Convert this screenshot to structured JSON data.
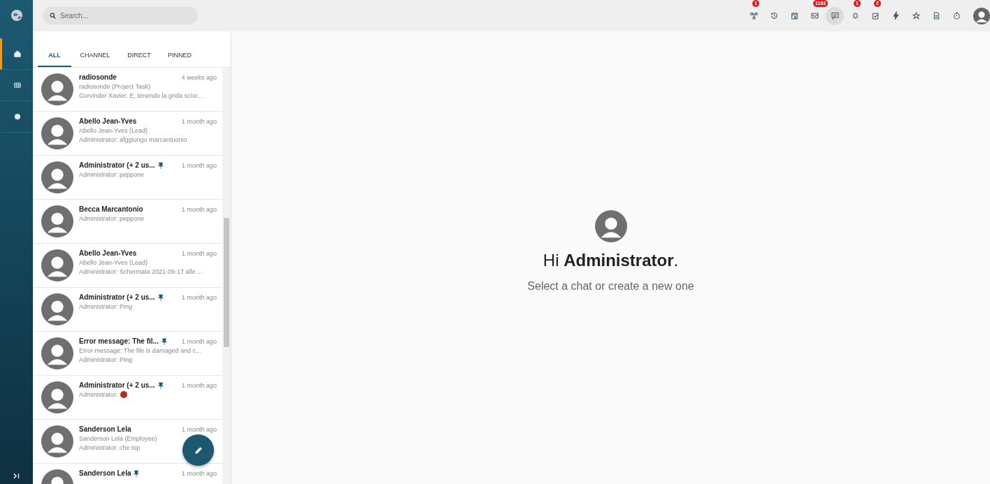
{
  "nav": {
    "items": [
      {
        "kind": "home",
        "selected": true
      },
      {
        "kind": "grid",
        "selected": false
      },
      {
        "kind": "gear",
        "selected": false
      }
    ]
  },
  "search": {
    "placeholder": "Search..."
  },
  "toolbar": {
    "items": [
      {
        "kind": "network",
        "badge": "1",
        "selected": false
      },
      {
        "kind": "history",
        "selected": false
      },
      {
        "kind": "calendar",
        "selected": false
      },
      {
        "kind": "mail",
        "badge": "1163",
        "selected": false
      },
      {
        "kind": "chat",
        "selected": true
      },
      {
        "kind": "bell",
        "badge": "1",
        "selected": false
      },
      {
        "kind": "task",
        "badge": "2",
        "selected": false
      },
      {
        "kind": "bolt",
        "selected": false
      },
      {
        "kind": "star",
        "selected": false
      },
      {
        "kind": "document",
        "selected": false
      },
      {
        "kind": "timer",
        "selected": false
      }
    ]
  },
  "tabs": [
    {
      "label": "ALL",
      "selected": true
    },
    {
      "label": "CHANNEL",
      "selected": false
    },
    {
      "label": "DIRECT",
      "selected": false
    },
    {
      "label": "PINNED",
      "selected": false
    }
  ],
  "chats": [
    {
      "title": "radiosonde",
      "pinned": false,
      "time": "4 weeks ago",
      "subtitle": "radiosonde (Project Task)",
      "preview": "Gurvinder Xavier: E, tenendo la grida scior..."
    },
    {
      "title": "Abello Jean-Yves",
      "pinned": false,
      "time": "1 month ago",
      "subtitle": "Abello Jean-Yves (Lead)",
      "preview": "Administrator: afggiungo marcantuonio"
    },
    {
      "title": "Administrator (+ 2 us...",
      "pinned": true,
      "time": "1 month ago",
      "preview": "Administrator: peppone"
    },
    {
      "title": "Becca Marcantonio",
      "pinned": false,
      "time": "1 month ago",
      "preview": "Administrator: peppone"
    },
    {
      "title": "Abello Jean-Yves",
      "pinned": false,
      "time": "1 month ago",
      "subtitle": "Abello Jean-Yves (Lead)",
      "preview": "Administrator: Schermata 2021-09-17 alle ..."
    },
    {
      "title": "Administrator (+ 2 us...",
      "pinned": true,
      "time": "1 month ago",
      "preview": "Administrator: Ping"
    },
    {
      "title": "Error message: The fil...",
      "pinned": true,
      "time": "1 month ago",
      "subtitle": "Error message: The file is damaged and c...",
      "preview": "Administrator: Ping"
    },
    {
      "title": "Administrator (+ 2 us...",
      "pinned": true,
      "time": "1 month ago",
      "preview": "Administrator:",
      "emoji": true
    },
    {
      "title": "Sanderson Lela",
      "pinned": false,
      "time": "1 month ago",
      "subtitle": "Sanderson Lela (Employee)",
      "preview": "Administrator: che top"
    },
    {
      "title": "Sanderson Lela",
      "pinned": true,
      "time": "1 month ago"
    }
  ],
  "welcome": {
    "greeting": "Hi **Administrator**.",
    "hint": "Select a chat or create a new one"
  }
}
